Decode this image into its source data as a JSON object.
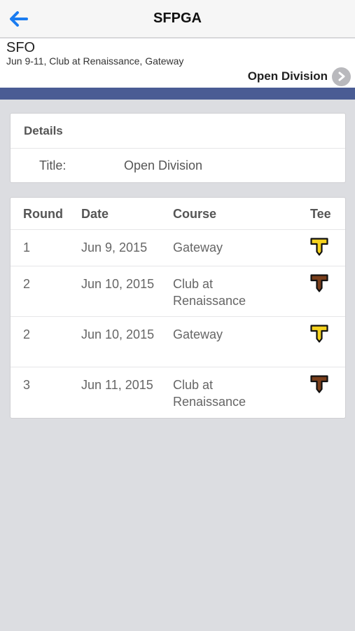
{
  "nav": {
    "title": "SFPGA",
    "back_icon": "back-arrow-icon"
  },
  "event": {
    "code": "SFO",
    "subtitle": "Jun 9-11, Club at Renaissance, Gateway",
    "division_label": "Open Division"
  },
  "details": {
    "heading": "Details",
    "title_key": "Title:",
    "title_value": "Open Division"
  },
  "rounds": {
    "headers": {
      "round": "Round",
      "date": "Date",
      "course": "Course",
      "tee": "Tee"
    },
    "rows": [
      {
        "round": "1",
        "date": "Jun 9, 2015",
        "course": "Gateway",
        "tee_color": "#f5d21e",
        "tee_icon": "yellow-tee-icon"
      },
      {
        "round": "2",
        "date": "Jun 10, 2015",
        "course": "Club at Renaissance",
        "tee_color": "#7a3f1c",
        "tee_icon": "brown-tee-icon"
      },
      {
        "round": "2",
        "date": "Jun 10, 2015",
        "course": "Gateway",
        "tee_color": "#f5d21e",
        "tee_icon": "yellow-tee-icon"
      },
      {
        "round": "3",
        "date": "Jun 11, 2015",
        "course": "Club at Renaissance",
        "tee_color": "#7a3f1c",
        "tee_icon": "brown-tee-icon"
      }
    ]
  },
  "colors": {
    "accent_blue": "#1a7cf0",
    "header_bar": "#4a5c94",
    "background": "#dcdde1"
  }
}
